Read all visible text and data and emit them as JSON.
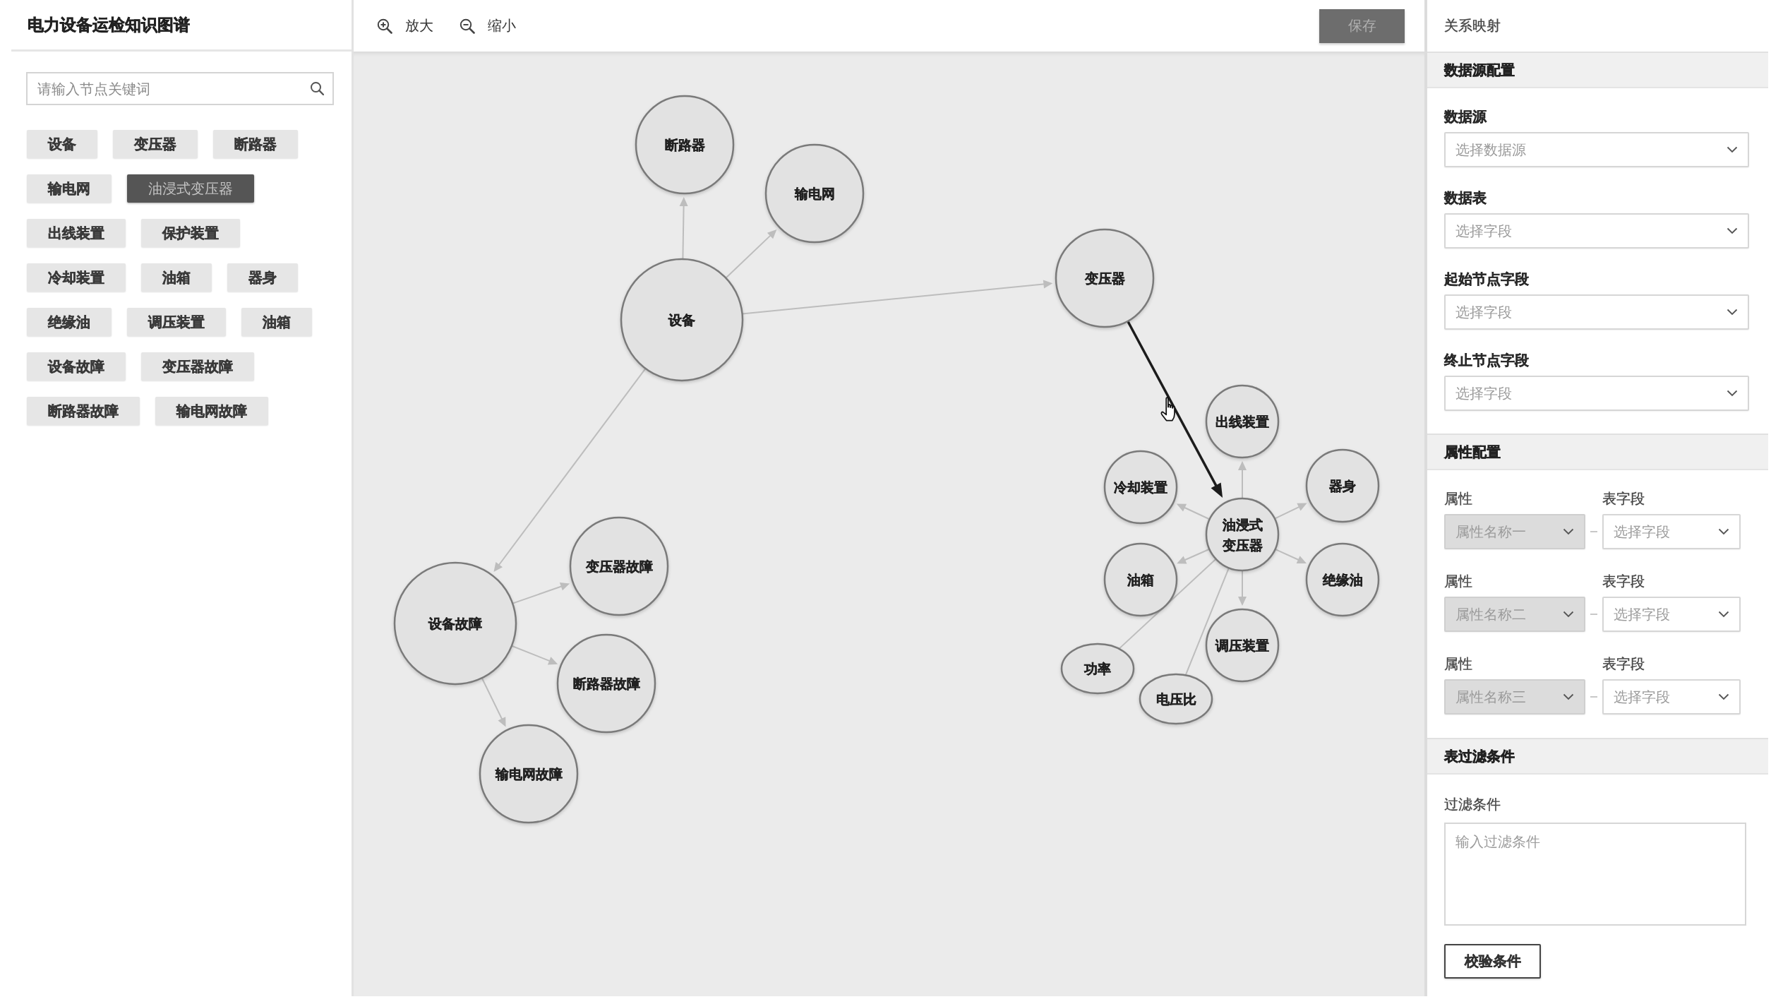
{
  "sidebar": {
    "title": "电力设备运检知识图谱",
    "search": {
      "placeholder": "请输入节点关键词"
    },
    "tags": [
      {
        "label": "设备",
        "selected": false
      },
      {
        "label": "变压器",
        "selected": false
      },
      {
        "label": "断路器",
        "selected": false
      },
      {
        "label": "输电网",
        "selected": false
      },
      {
        "label": "油浸式变压器",
        "selected": true
      },
      {
        "label": "出线装置",
        "selected": false
      },
      {
        "label": "保护装置",
        "selected": false
      },
      {
        "label": "冷却装置",
        "selected": false
      },
      {
        "label": "油箱",
        "selected": false
      },
      {
        "label": "器身",
        "selected": false
      },
      {
        "label": "绝缘油",
        "selected": false
      },
      {
        "label": "调压装置",
        "selected": false
      },
      {
        "label": "油箱",
        "selected": false
      },
      {
        "label": "设备故障",
        "selected": false
      },
      {
        "label": "变压器故障",
        "selected": false
      },
      {
        "label": "断路器故障",
        "selected": false
      },
      {
        "label": "输电网故障",
        "selected": false
      }
    ]
  },
  "toolbar": {
    "buttons": [
      {
        "kind": "zoom_in",
        "label": "放大"
      },
      {
        "kind": "zoom_out",
        "label": "缩小"
      }
    ],
    "save_button": {
      "label": "保存"
    }
  },
  "graph": {
    "root": {
      "label": "设备",
      "kind": "entity",
      "children": [
        {
          "label": "断路器",
          "kind": "entity",
          "link": {
            "kind": "relation",
            "highlighted": false
          }
        },
        {
          "label": "输电网",
          "kind": "entity",
          "link": {
            "kind": "relation",
            "highlighted": false
          }
        },
        {
          "label": "变压器",
          "kind": "entity",
          "link": {
            "kind": "relation",
            "highlighted": false
          },
          "children": [
            {
              "label": "油浸式变压器",
              "kind": "entity",
              "link": {
                "kind": "relation",
                "highlighted": true
              },
              "children": [
                {
                  "label": "出线装置",
                  "kind": "entity",
                  "link": {
                    "kind": "relation",
                    "highlighted": false
                  }
                },
                {
                  "label": "冷却装置",
                  "kind": "entity",
                  "link": {
                    "kind": "relation",
                    "highlighted": false
                  }
                },
                {
                  "label": "器身",
                  "kind": "entity",
                  "link": {
                    "kind": "relation",
                    "highlighted": false
                  }
                },
                {
                  "label": "油箱",
                  "kind": "entity",
                  "link": {
                    "kind": "relation",
                    "highlighted": false
                  }
                },
                {
                  "label": "绝缘油",
                  "kind": "entity",
                  "link": {
                    "kind": "relation",
                    "highlighted": false
                  }
                },
                {
                  "label": "调压装置",
                  "kind": "entity",
                  "link": {
                    "kind": "relation",
                    "highlighted": false
                  }
                },
                {
                  "label": "功率",
                  "kind": "attribute",
                  "link": {
                    "kind": "attribute",
                    "highlighted": false
                  }
                },
                {
                  "label": "电压比",
                  "kind": "attribute",
                  "link": {
                    "kind": "attribute",
                    "highlighted": false
                  }
                }
              ]
            }
          ]
        },
        {
          "label": "设备故障",
          "kind": "entity",
          "link": {
            "kind": "relation",
            "highlighted": false
          },
          "children": [
            {
              "label": "变压器故障",
              "kind": "entity",
              "link": {
                "kind": "relation",
                "highlighted": false
              }
            },
            {
              "label": "断路器故障",
              "kind": "entity",
              "link": {
                "kind": "relation",
                "highlighted": false
              }
            },
            {
              "label": "输电网故障",
              "kind": "entity",
              "link": {
                "kind": "relation",
                "highlighted": false
              }
            }
          ]
        }
      ]
    }
  },
  "mapping_panel": {
    "title": "关系映射",
    "sections": [
      {
        "kind": "fields",
        "title": "数据源配置",
        "fields": [
          {
            "label": "数据源",
            "placeholder": "选择数据源"
          },
          {
            "label": "数据表",
            "placeholder": "选择字段"
          },
          {
            "label": "起始节点字段",
            "placeholder": "选择字段"
          },
          {
            "label": "终止节点字段",
            "placeholder": "选择字段"
          }
        ]
      },
      {
        "kind": "attributes",
        "title": "属性配置",
        "rows": [
          {
            "attribute": {
              "label": "属性",
              "value": "属性名称一",
              "disabled": true
            },
            "field": {
              "label": "表字段",
              "placeholder": "选择字段",
              "disabled": false
            }
          },
          {
            "attribute": {
              "label": "属性",
              "value": "属性名称二",
              "disabled": true
            },
            "field": {
              "label": "表字段",
              "placeholder": "选择字段",
              "disabled": false
            }
          },
          {
            "attribute": {
              "label": "属性",
              "value": "属性名称三",
              "disabled": true
            },
            "field": {
              "label": "表字段",
              "placeholder": "选择字段",
              "disabled": false
            }
          }
        ]
      },
      {
        "kind": "filter",
        "title": "表过滤条件",
        "label": "过滤条件",
        "placeholder": "输入过滤条件",
        "button": "校验条件"
      }
    ]
  }
}
